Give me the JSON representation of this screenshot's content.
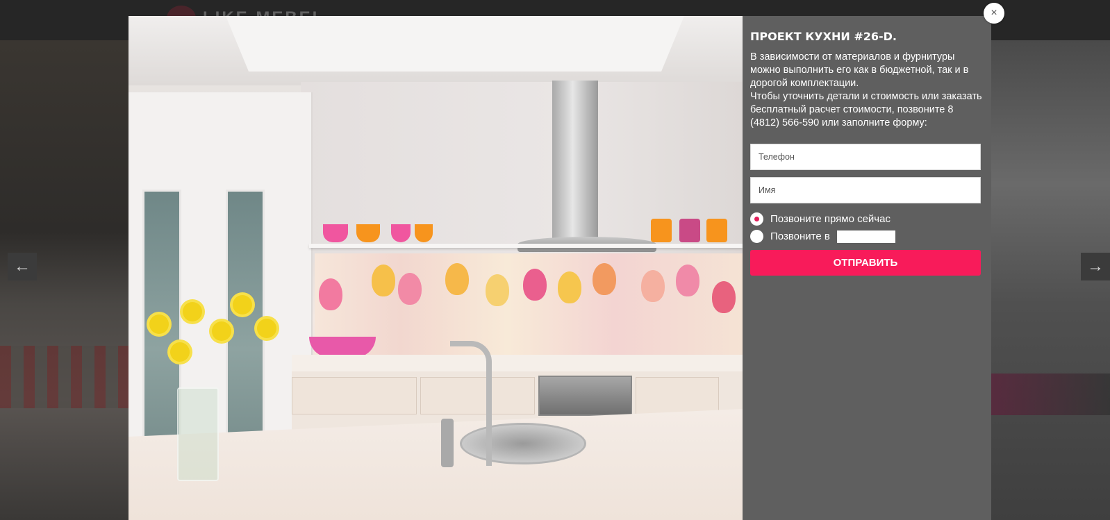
{
  "background": {
    "logo_text": "LIKE MEBEL",
    "prev_arrow_glyph": "←",
    "next_arrow_glyph": "→"
  },
  "modal": {
    "close_glyph": "×",
    "title": "ПРОЕКТ КУХНИ #26-D.",
    "description": "В зависимости от материалов и фурнитуры можно выполнить его как в бюджетной, так и в дорогой комплектации.\nЧтобы уточнить детали и стоимость или заказать бесплатный расчет стоимости, позвоните 8 (4812) 566-590 или заполните форму:",
    "form": {
      "phone_placeholder": "Телефон",
      "phone_value": "",
      "name_placeholder": "Имя",
      "name_value": "",
      "radio_now_label": "Позвоните прямо сейчас",
      "radio_now_selected": true,
      "radio_at_label": "Позвоните в",
      "radio_at_selected": false,
      "time_value": "",
      "submit_label": "ОТПРАВИТЬ"
    }
  },
  "icons": {
    "close": "close-icon",
    "prev": "arrow-left-icon",
    "next": "arrow-right-icon"
  },
  "colors": {
    "accent": "#f81b5a",
    "panel": "#5f5f5f",
    "overlay": "#2a2a2a"
  }
}
